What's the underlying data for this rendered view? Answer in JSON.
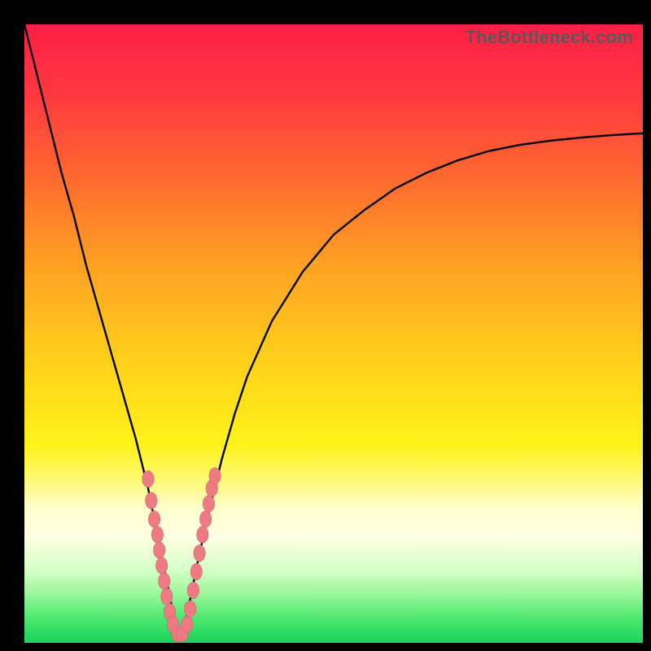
{
  "watermark": "TheBottleneck.com",
  "chart_data": {
    "type": "line",
    "title": "",
    "xlabel": "",
    "ylabel": "",
    "xlim": [
      0,
      100
    ],
    "ylim": [
      0,
      100
    ],
    "grid": false,
    "legend": false,
    "series": [
      {
        "name": "bottleneck-curve",
        "x": [
          0,
          2,
          4,
          6,
          8,
          10,
          12,
          14,
          16,
          18,
          20,
          21,
          22,
          23,
          24,
          25,
          26,
          27,
          28,
          30,
          32,
          34,
          36,
          40,
          45,
          50,
          55,
          60,
          65,
          70,
          75,
          80,
          85,
          90,
          95,
          100
        ],
        "y": [
          100,
          92,
          84,
          76,
          69,
          61,
          54,
          47,
          40,
          33,
          25,
          20,
          15,
          10,
          5,
          1,
          3,
          8,
          13,
          22,
          30,
          37,
          43,
          52,
          60,
          66,
          70,
          73.5,
          76,
          78,
          79.5,
          80.5,
          81.2,
          81.7,
          82.1,
          82.4
        ]
      }
    ],
    "points": [
      {
        "x": 20.0,
        "y": 26.5
      },
      {
        "x": 20.5,
        "y": 23.0
      },
      {
        "x": 21.0,
        "y": 20.0
      },
      {
        "x": 21.5,
        "y": 17.5
      },
      {
        "x": 21.8,
        "y": 15.0
      },
      {
        "x": 22.2,
        "y": 12.5
      },
      {
        "x": 22.6,
        "y": 10.0
      },
      {
        "x": 23.0,
        "y": 7.5
      },
      {
        "x": 23.5,
        "y": 5.0
      },
      {
        "x": 24.0,
        "y": 3.0
      },
      {
        "x": 24.7,
        "y": 1.5
      },
      {
        "x": 25.5,
        "y": 1.5
      },
      {
        "x": 26.3,
        "y": 3.0
      },
      {
        "x": 26.8,
        "y": 5.5
      },
      {
        "x": 27.3,
        "y": 8.5
      },
      {
        "x": 27.8,
        "y": 11.5
      },
      {
        "x": 28.3,
        "y": 14.5
      },
      {
        "x": 28.8,
        "y": 17.5
      },
      {
        "x": 29.3,
        "y": 20.0
      },
      {
        "x": 29.8,
        "y": 22.5
      },
      {
        "x": 30.3,
        "y": 25.0
      },
      {
        "x": 30.8,
        "y": 27.0
      }
    ],
    "gradient_stops": [
      {
        "offset": 0.0,
        "color": "#ff1e46"
      },
      {
        "offset": 0.12,
        "color": "#ff3a3f"
      },
      {
        "offset": 0.25,
        "color": "#ff6a30"
      },
      {
        "offset": 0.4,
        "color": "#ffa422"
      },
      {
        "offset": 0.55,
        "color": "#ffd21a"
      },
      {
        "offset": 0.68,
        "color": "#fff21a"
      },
      {
        "offset": 0.74,
        "color": "#fff97a"
      },
      {
        "offset": 0.78,
        "color": "#fffdc9"
      },
      {
        "offset": 0.83,
        "color": "#fdffe4"
      },
      {
        "offset": 0.88,
        "color": "#d8ffc8"
      },
      {
        "offset": 0.92,
        "color": "#9cf79b"
      },
      {
        "offset": 0.96,
        "color": "#4fe770"
      },
      {
        "offset": 1.0,
        "color": "#16d45a"
      }
    ]
  }
}
